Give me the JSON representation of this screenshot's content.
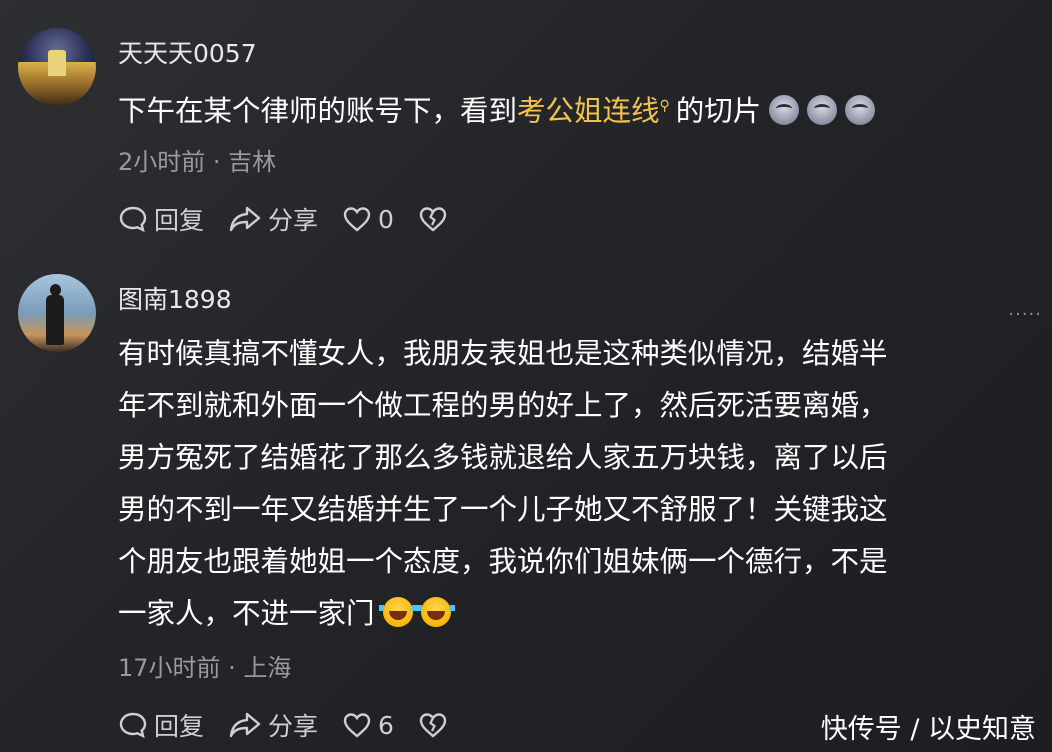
{
  "comments": [
    {
      "username": "天天天0057",
      "text_before": "下午在某个律师的账号下，看到",
      "link_text": "考公姐连线",
      "search_icon": "search-icon",
      "text_after": "的切片",
      "emojis": [
        "dog-grin-emoji",
        "dog-grin-emoji",
        "dog-grin-emoji"
      ],
      "meta": "2小时前 · 吉林",
      "actions": {
        "reply": "回复",
        "share": "分享",
        "like_count": "0"
      }
    },
    {
      "username": "图南1898",
      "lines": [
        "有时候真搞不懂女人，我朋友表姐也是这种类似情况，结婚半",
        "年不到就和外面一个做工程的男的好上了，然后死活要离婚，",
        "男方冤死了结婚花了那么多钱就退给人家五万块钱，离了以后",
        "男的不到一年又结婚并生了一个儿子她又不舒服了！关键我这",
        "个朋友也跟着她姐一个态度，我说你们姐妹俩一个德行，不是",
        "一家人，不进一家门"
      ],
      "emojis": [
        "laugh-cry-emoji",
        "laugh-cry-emoji"
      ],
      "meta": "17小时前 · 上海",
      "actions": {
        "reply": "回复",
        "share": "分享",
        "like_count": "6"
      }
    }
  ],
  "watermark": "快传号 / 以史知意",
  "colors": {
    "link": "#f4c24b",
    "meta": "#9a9a9e",
    "background": "#26272b"
  }
}
